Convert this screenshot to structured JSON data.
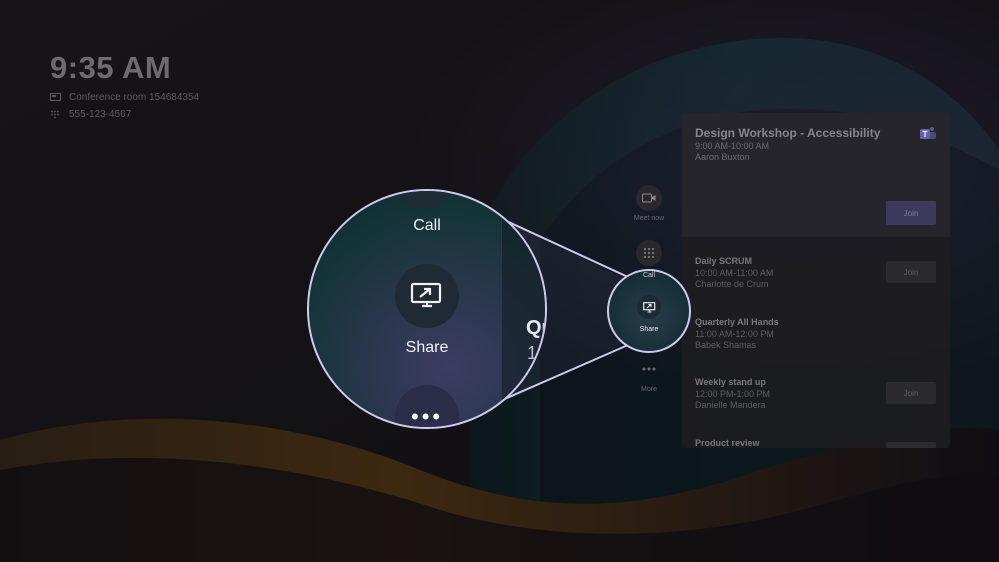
{
  "clock": {
    "time": "9:35 AM",
    "room": "Conference room 154684354",
    "phone": "555-123-4567"
  },
  "rail": {
    "meet_now": "Meet now",
    "call": "Call",
    "share": "Share",
    "more": "More"
  },
  "featured": {
    "title": "Design Workshop - Accessibility",
    "time": "9:00 AM-10:00 AM",
    "organizer": "Aaron Buxton",
    "join": "Join"
  },
  "meetings": [
    {
      "title": "Daily SCRUM",
      "time": "10:00 AM-11:00 AM",
      "organizer": "Charlotte de Crum",
      "join": "Join"
    },
    {
      "title": "Quarterly All Hands",
      "time": "11:00 AM-12:00 PM",
      "organizer": "Babek Shamas",
      "join": ""
    },
    {
      "title": "Weekly stand up",
      "time": "12:00 PM-1:00 PM",
      "organizer": "Danielle Mandera",
      "join": "Join"
    },
    {
      "title": "Product review",
      "time": "",
      "organizer": "",
      "join": ""
    }
  ],
  "zoom": {
    "call": "Call",
    "share": "Share",
    "peek_title": "Qu",
    "peek_sub": "1",
    "more_dots": "•••"
  },
  "colors": {
    "highlight_ring": "#cfc8ef",
    "join_primary": "#3b3a5c"
  }
}
